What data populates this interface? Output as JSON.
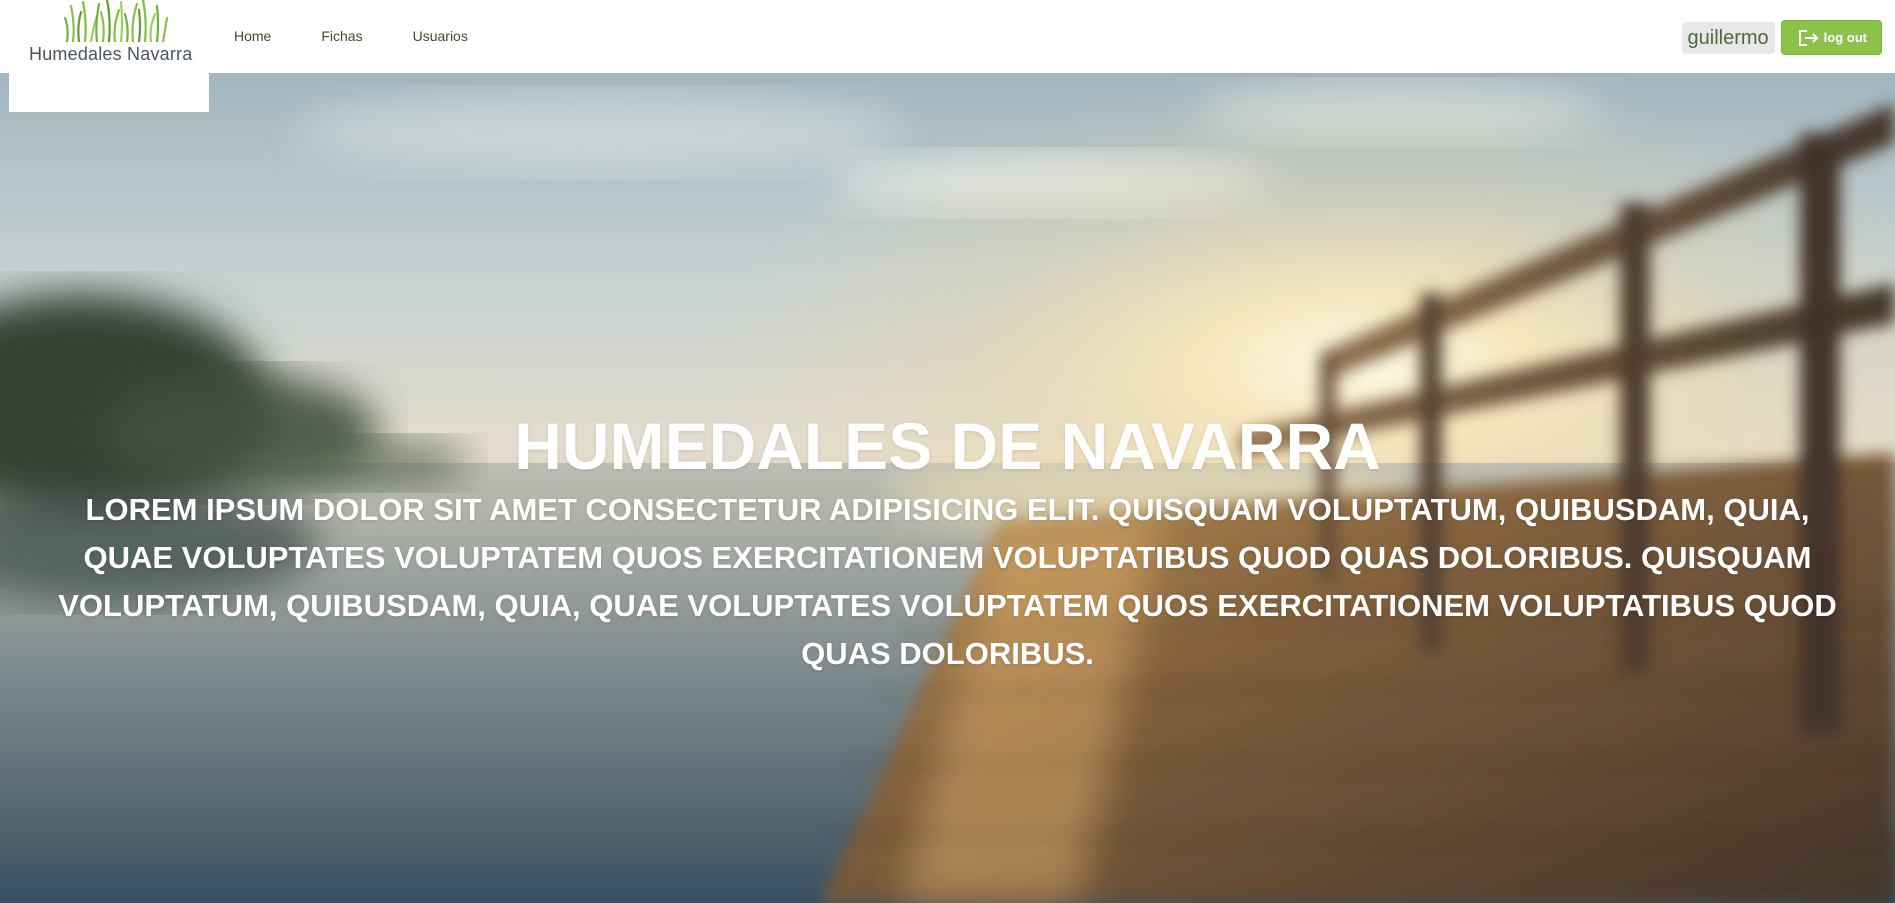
{
  "brand": {
    "name": "Humedales Navarra",
    "icon": "grass-logo-icon",
    "accent": "#8cc24a"
  },
  "nav": {
    "items": [
      {
        "label": "Home"
      },
      {
        "label": "Fichas"
      },
      {
        "label": "Usuarios"
      }
    ]
  },
  "user": {
    "name": "guillermo",
    "logout_label": "log out",
    "logout_icon": "logout-icon"
  },
  "hero": {
    "title": "HUMEDALES DE NAVARRA",
    "subtitle": "LOREM IPSUM DOLOR SIT AMET CONSECTETUR ADIPISICING ELIT. QUISQUAM VOLUPTATUM, QUIBUSDAM, QUIA, QUAE VOLUPTATES VOLUPTATEM QUOS EXERCITATIONEM VOLUPTATIBUS QUOD QUAS DOLORIBUS. QUISQUAM VOLUPTATUM, QUIBUSDAM, QUIA, QUAE VOLUPTATES VOLUPTATEM QUOS EXERCITATIONEM VOLUPTATIBUS QUOD QUAS DOLORIBUS."
  }
}
